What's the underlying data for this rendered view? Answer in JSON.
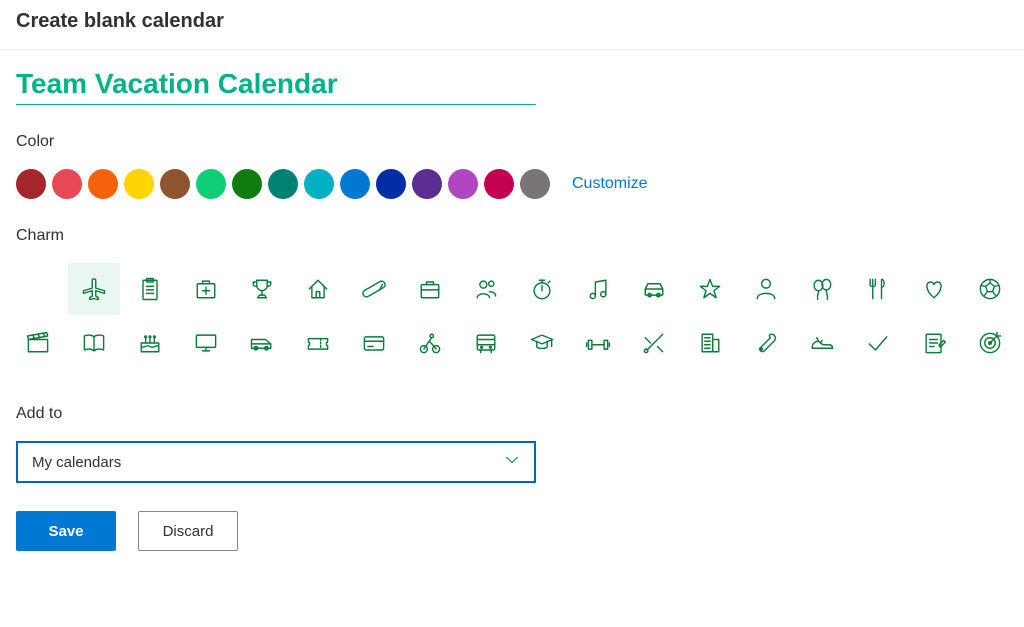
{
  "header": {
    "title": "Create blank calendar"
  },
  "calendar": {
    "name": "Team Vacation Calendar"
  },
  "sections": {
    "color": {
      "label": "Color",
      "customize": "Customize"
    },
    "charm": {
      "label": "Charm"
    },
    "add_to": {
      "label": "Add to",
      "value": "My calendars"
    }
  },
  "colors": {
    "selected_index": 5,
    "swatches": [
      "#a4262c",
      "#e74856",
      "#f7630c",
      "#ffd400",
      "#8e562e",
      "#0ecf78",
      "#107c10",
      "#008272",
      "#00b0c3",
      "#0078d4",
      "#002ea6",
      "#5c2d91",
      "#b146c2",
      "#c30052",
      "#7a7574"
    ]
  },
  "charms": {
    "selected": "airplane",
    "row1": [
      "none",
      "airplane",
      "clipboard",
      "first-aid",
      "trophy",
      "home",
      "pill",
      "briefcase",
      "people",
      "stopwatch",
      "music",
      "car",
      "star",
      "person",
      "balloons",
      "fork-knife",
      "heart",
      "soccer"
    ],
    "row2": [
      "clapperboard",
      "book",
      "cake",
      "monitor",
      "van",
      "ticket",
      "credit-card",
      "cycling",
      "bus",
      "graduation",
      "dumbbell",
      "tools",
      "building",
      "wrench",
      "running-shoe",
      "checkmark",
      "notepad",
      "target"
    ]
  },
  "buttons": {
    "save": "Save",
    "discard": "Discard"
  }
}
